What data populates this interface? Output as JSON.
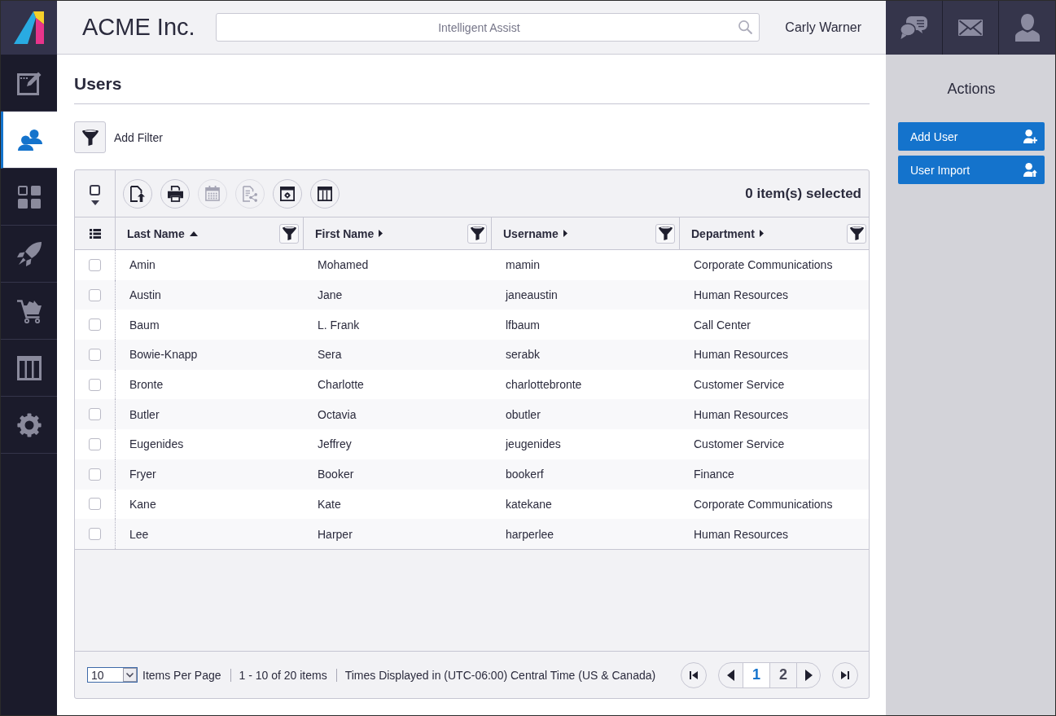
{
  "app": {
    "name": "ACME Inc."
  },
  "search": {
    "placeholder": "Intelligent Assist"
  },
  "user": {
    "name": "Carly Warner"
  },
  "header_buttons": [
    {
      "kind": "help"
    },
    {
      "kind": "mail"
    },
    {
      "kind": "profile"
    }
  ],
  "sidebar": {
    "items": [
      {
        "kind": "editor",
        "selected": false
      },
      {
        "kind": "users",
        "selected": true
      },
      {
        "kind": "dashboard",
        "selected": false
      },
      {
        "kind": "rocket",
        "selected": false
      },
      {
        "kind": "cart",
        "selected": false
      },
      {
        "kind": "table",
        "selected": false
      },
      {
        "kind": "settings",
        "selected": false
      }
    ]
  },
  "page": {
    "title": "Users"
  },
  "filter": {
    "label": "Add Filter"
  },
  "table": {
    "select_all": {
      "checked": false
    },
    "toolbar": [
      {
        "kind": "export",
        "disabled": false
      },
      {
        "kind": "print",
        "disabled": false
      },
      {
        "kind": "calendar",
        "disabled": true
      },
      {
        "kind": "report",
        "disabled": true
      },
      {
        "kind": "settings",
        "disabled": false
      },
      {
        "kind": "columns",
        "disabled": false
      }
    ],
    "selection_count": "0 item(s) selected",
    "columns": [
      {
        "label": "Last Name",
        "sorted": true
      },
      {
        "label": "First Name",
        "sorted": false
      },
      {
        "label": "Username",
        "sorted": false
      },
      {
        "label": "Department",
        "sorted": false
      }
    ],
    "rows": [
      {
        "checked": false,
        "cells": [
          "Amin",
          "Mohamed",
          "mamin",
          "Corporate Communications"
        ]
      },
      {
        "checked": false,
        "cells": [
          "Austin",
          "Jane",
          "janeaustin",
          "Human Resources"
        ]
      },
      {
        "checked": false,
        "cells": [
          "Baum",
          "L. Frank",
          "lfbaum",
          "Call Center"
        ]
      },
      {
        "checked": false,
        "cells": [
          "Bowie-Knapp",
          "Sera",
          "serabk",
          "Human Resources"
        ]
      },
      {
        "checked": false,
        "cells": [
          "Bronte",
          "Charlotte",
          "charlottebronte",
          "Customer Service"
        ]
      },
      {
        "checked": false,
        "cells": [
          "Butler",
          "Octavia",
          "obutler",
          "Human Resources"
        ]
      },
      {
        "checked": false,
        "cells": [
          "Eugenides",
          "Jeffrey",
          "jeugenides",
          "Customer Service"
        ]
      },
      {
        "checked": false,
        "cells": [
          "Fryer",
          "Booker",
          "bookerf",
          "Finance"
        ]
      },
      {
        "checked": false,
        "cells": [
          "Kane",
          "Kate",
          "katekane",
          "Corporate Communications"
        ]
      },
      {
        "checked": false,
        "cells": [
          "Lee",
          "Harper",
          "harperlee",
          "Human Resources"
        ]
      }
    ]
  },
  "footer": {
    "page_size": "10",
    "page_size_label": "Items Per Page",
    "range": "1 - 10 of 20 items",
    "timezone": "Times Displayed in (UTC-06:00) Central Time (US & Canada)",
    "pages": [
      {
        "label": "1",
        "selected": true
      },
      {
        "label": "2",
        "selected": false
      }
    ]
  },
  "actions": {
    "title": "Actions",
    "buttons": [
      {
        "label": "Add User",
        "kind": "add"
      },
      {
        "label": "User Import",
        "kind": "import"
      }
    ]
  }
}
